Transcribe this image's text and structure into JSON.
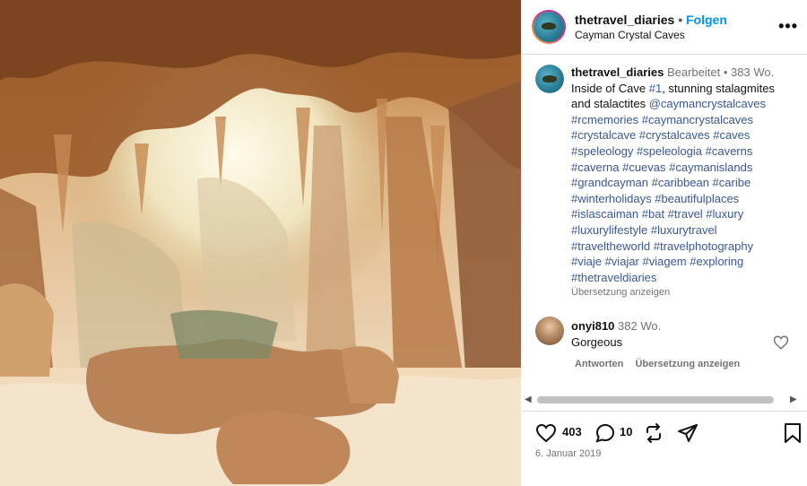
{
  "post": {
    "image_alt": "Cave interior with stalactites and stalagmites",
    "image_description_icon": "photo"
  },
  "header": {
    "username": "thetravel_diaries",
    "separator": "•",
    "follow_label": "Folgen",
    "location": "Cayman Crystal Caves",
    "more_label": "•••"
  },
  "caption": {
    "username": "thetravel_diaries",
    "edited_label": "Bearbeitet",
    "separator": "•",
    "time": "383 Wo.",
    "text_before": "Inside of Cave ",
    "hashtag_one": "#1",
    "text_after": ", stunning stalagmites and stalactites ",
    "mention": "@caymancrystalcaves",
    "hashtags_lines": [
      "#rcmemories #caymancrystalcaves",
      "#crystalcave #crystalcaves #caves",
      "#speleology #speleologia #caverns",
      "#caverna #cuevas #caymanislands",
      "#grandcayman #caribbean #caribe",
      "#winterholidays #beautifulplaces",
      "#islascaiman #bat #travel #luxury",
      "#luxurylifestyle #luxurytravel",
      "#traveltheworld #travelphotography",
      "#viaje #viajar #viagem #exploring",
      "#thetraveldiaries"
    ],
    "translate_label": "Übersetzung anzeigen"
  },
  "comment": {
    "username": "onyi810",
    "time": "382 Wo.",
    "text": "Gorgeous",
    "reply_label": "Antworten",
    "translate_label": "Übersetzung anzeigen"
  },
  "actions": {
    "likes": "403",
    "comments": "10",
    "date": "6. Januar 2019"
  },
  "colors": {
    "link": "#385898",
    "follow": "#0095f6",
    "muted": "#737373"
  }
}
